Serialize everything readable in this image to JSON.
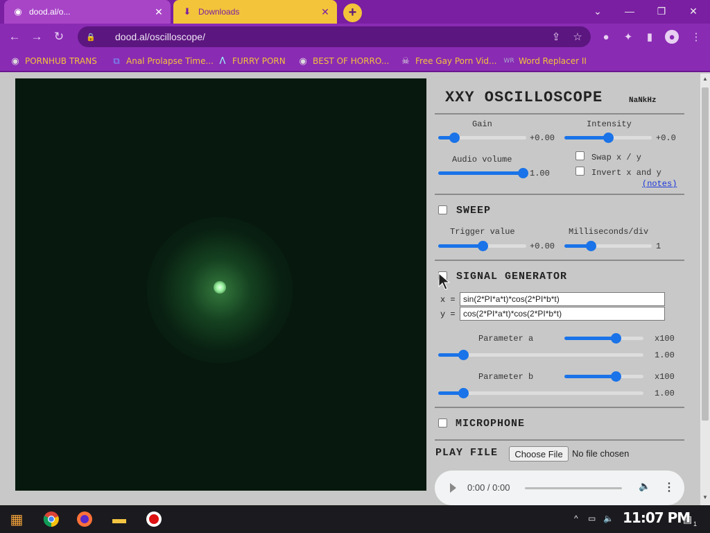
{
  "browser": {
    "tabs": [
      {
        "label": "dood.al/o...",
        "active": true,
        "icon": "globe-icon"
      },
      {
        "label": "Downloads",
        "active": false,
        "icon": "download-icon"
      }
    ],
    "new_tab": "+",
    "url": "dood.al/oscilloscope/",
    "bookmarks": [
      {
        "label": "PORNHUB TRANS",
        "icon": "globe-icon"
      },
      {
        "label": "Anal Prolapse Time...",
        "icon": "bracket-icon"
      },
      {
        "label": "FURRY PORN",
        "icon": "lambda-icon"
      },
      {
        "label": "BEST OF HORRO...",
        "icon": "globe-icon"
      },
      {
        "label": "Free Gay Porn Vid...",
        "icon": "skull-icon"
      },
      {
        "label": "Word Replacer II",
        "icon": "wr-icon"
      }
    ],
    "accent": "#7a1fa2",
    "bookmark_color": "#f3c43a"
  },
  "scope": {
    "background": "#07190e",
    "beam_color": "#9af29f"
  },
  "panel": {
    "title": "XXY OSCILLOSCOPE",
    "freq": "NaNkHz",
    "gain": {
      "label": "Gain",
      "value": "+0.00",
      "level": 0.18
    },
    "intensity": {
      "label": "Intensity",
      "value": "+0.0",
      "level": 0.5
    },
    "audio_volume": {
      "label": "Audio volume",
      "value": "1.00",
      "level": 0.96
    },
    "swap_xy": {
      "label": "Swap x / y",
      "checked": false
    },
    "invert_xy": {
      "label": "Invert x and y",
      "checked": false
    },
    "notes": "(notes)",
    "sweep": {
      "label": "SWEEP",
      "checked": false,
      "trigger": {
        "label": "Trigger value",
        "value": "+0.00",
        "level": 0.5
      },
      "ms_div": {
        "label": "Milliseconds/div",
        "value": "1",
        "level": 0.3
      }
    },
    "signal_generator": {
      "label": "SIGNAL GENERATOR",
      "checked": false,
      "x_label": "x =",
      "x_expr": "sin(2*PI*a*t)*cos(2*PI*b*t)",
      "y_label": "y =",
      "y_expr": "cos(2*PI*a*t)*cos(2*PI*b*t)",
      "param_a": {
        "label": "Parameter a",
        "mult": "x100",
        "value": "1.00",
        "mult_level": 0.65,
        "level": 0.12
      },
      "param_b": {
        "label": "Parameter b",
        "mult": "x100",
        "value": "1.00",
        "mult_level": 0.65,
        "level": 0.12
      }
    },
    "microphone": {
      "label": "MICROPHONE",
      "checked": false
    },
    "play_file": {
      "label": "PLAY FILE",
      "button": "Choose File",
      "status": "No file chosen",
      "time": "0:00 / 0:00"
    }
  },
  "taskbar": {
    "clock": "11:07 PM",
    "notification_count": "1"
  }
}
